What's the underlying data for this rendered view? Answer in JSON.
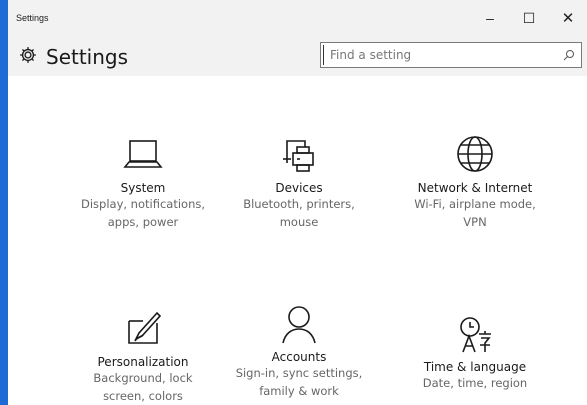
{
  "window": {
    "title": "Settings",
    "controls": {
      "minimize": "–",
      "maximize": "☐",
      "close": "✕"
    }
  },
  "header": {
    "title": "Settings",
    "search": {
      "placeholder": "Find a setting"
    }
  },
  "tiles": [
    {
      "title": "System",
      "desc1": "Display, notifications,",
      "desc2": "apps, power",
      "icon": "laptop-icon"
    },
    {
      "title": "Devices",
      "desc1": "Bluetooth, printers,",
      "desc2": "mouse",
      "icon": "devices-printer-icon"
    },
    {
      "title": "Network & Internet",
      "desc1": "Wi-Fi, airplane mode,",
      "desc2": "VPN",
      "icon": "globe-icon"
    },
    {
      "title": "Personalization",
      "desc1": "Background, lock",
      "desc2": "screen, colors",
      "icon": "personalization-icon"
    },
    {
      "title": "Accounts",
      "desc1": "Sign-in, sync settings,",
      "desc2": "family & work",
      "icon": "person-icon"
    },
    {
      "title": "Time & language",
      "desc1": "Date, time, region",
      "desc2": "",
      "icon": "time-language-icon"
    }
  ],
  "colors": {
    "desktop": "#1e6bd6",
    "accent": "#0063b1"
  }
}
